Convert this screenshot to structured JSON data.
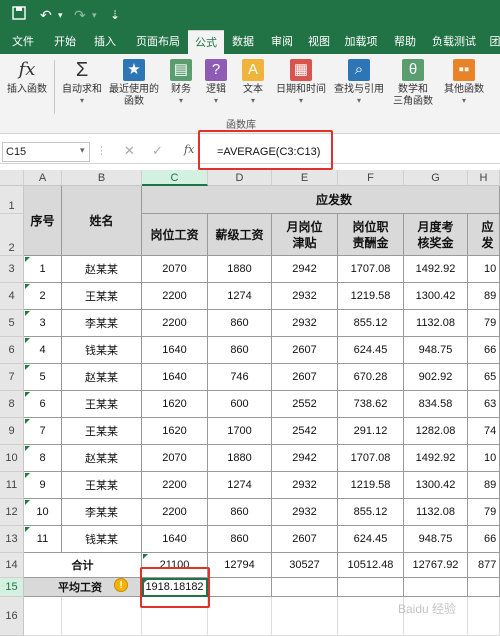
{
  "quick_access": {
    "save_icon": "save-icon",
    "undo_icon": "undo-icon",
    "redo_icon": "redo-icon"
  },
  "tabs": [
    "文件",
    "开始",
    "插入",
    "页面布局",
    "公式",
    "数据",
    "审阅",
    "视图",
    "加载项",
    "帮助",
    "负载测试",
    "团"
  ],
  "active_tab": "公式",
  "ribbon": {
    "buttons": [
      "插入函数",
      "自动求和",
      "最近使用的\n函数",
      "财务",
      "逻辑",
      "文本",
      "日期和时间",
      "查找与引用",
      "数学和\n三角函数",
      "其他函数"
    ],
    "group_label": "函数库"
  },
  "formula_bar": {
    "name_box": "C15",
    "fx": "fx",
    "formula": "=AVERAGE(C3:C13)"
  },
  "columns": [
    "A",
    "B",
    "C",
    "D",
    "E",
    "F",
    "G",
    "H"
  ],
  "rows": [
    "1",
    "2",
    "3",
    "4",
    "5",
    "6",
    "7",
    "8",
    "9",
    "10",
    "11",
    "12",
    "13",
    "14",
    "15",
    "16"
  ],
  "table": {
    "h_seq": "序号",
    "h_name": "姓名",
    "h_group": "应发数",
    "h_sub": [
      "岗位工资",
      "薪级工资",
      "月岗位\n津贴",
      "岗位职\n责酬金",
      "月度考\n核奖金",
      "应发"
    ],
    "rows": [
      [
        "1",
        "赵某某",
        "2070",
        "1880",
        "2942",
        "1707.08",
        "1492.92",
        "10"
      ],
      [
        "2",
        "王某某",
        "2200",
        "1274",
        "2932",
        "1219.58",
        "1300.42",
        "89"
      ],
      [
        "3",
        "李某某",
        "2200",
        "860",
        "2932",
        "855.12",
        "1132.08",
        "79"
      ],
      [
        "4",
        "钱某某",
        "1640",
        "860",
        "2607",
        "624.45",
        "948.75",
        "66"
      ],
      [
        "5",
        "赵某某",
        "1640",
        "746",
        "2607",
        "670.28",
        "902.92",
        "65"
      ],
      [
        "6",
        "王某某",
        "1620",
        "600",
        "2552",
        "738.62",
        "834.58",
        "63"
      ],
      [
        "7",
        "王某某",
        "1620",
        "1700",
        "2542",
        "291.12",
        "1282.08",
        "74"
      ],
      [
        "8",
        "赵某某",
        "2070",
        "1880",
        "2942",
        "1707.08",
        "1492.92",
        "10"
      ],
      [
        "9",
        "王某某",
        "2200",
        "1274",
        "2932",
        "1219.58",
        "1300.42",
        "89"
      ],
      [
        "10",
        "李某某",
        "2200",
        "860",
        "2932",
        "855.12",
        "1132.08",
        "79"
      ],
      [
        "11",
        "钱某某",
        "1640",
        "860",
        "2607",
        "624.45",
        "948.75",
        "66"
      ]
    ],
    "total_label": "合计",
    "totals": [
      "21100",
      "12794",
      "30527",
      "10512.48",
      "12767.92",
      "877"
    ],
    "avg_label": "平均工资",
    "avg_value": "1918.18182"
  },
  "watermark": "Baidu 经验",
  "colors": {
    "excel_green": "#217346",
    "header_grey": "#d9d9d9",
    "highlight_red": "#e0312b"
  }
}
